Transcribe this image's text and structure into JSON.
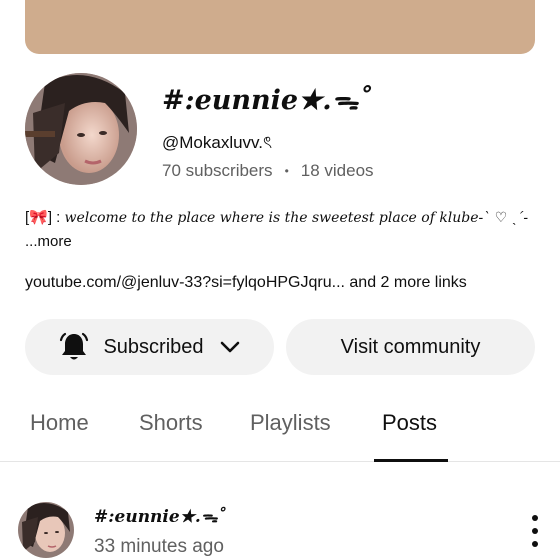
{
  "channel": {
    "name": "#:eunnie★.ᯓ˚",
    "handle": "@Mokaxluvv.ৎ",
    "subscribers": "70 subscribers",
    "separator": "•",
    "videos": "18 videos",
    "description_prefix": "[🎀] : ",
    "description_fancy": "welcome to the place where is the sweetest place of klube-ˋ ♡ ˎ´-",
    "description_more": " ...more",
    "link_text": "youtube.com/@jenluv-33?si=fylqoHPGJqru...",
    "link_extra": " and 2 more links",
    "banner_color": "#cfac8d"
  },
  "buttons": {
    "subscribed_label": "Subscribed",
    "bell_icon": "bell-icon",
    "chevron_icon": "chevron-down-icon",
    "visit_label": "Visit community"
  },
  "tabs": [
    {
      "label": "Home",
      "active": false
    },
    {
      "label": "Shorts",
      "active": false
    },
    {
      "label": "Playlists",
      "active": false
    },
    {
      "label": "Posts",
      "active": true
    }
  ],
  "post": {
    "author": "#:eunnie★.ᯓ˚",
    "time": "33 minutes ago",
    "menu_icon": "more-vertical-icon"
  }
}
